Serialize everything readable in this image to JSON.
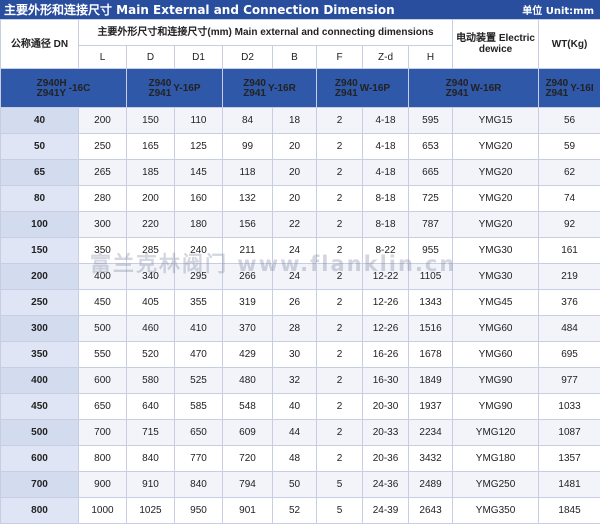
{
  "title": "主要外形和连接尺寸 Main External and Connection Dimension",
  "unit": "单位 Unit:mm",
  "headers": {
    "dn": "公称通径 DN",
    "dims_group": "主要外形尺寸和连接尺寸(mm) Main external and connecting dimensions",
    "electric": "电动装置 Electric dewice",
    "wt": "WT(Kg)",
    "cols": [
      "L",
      "D",
      "D1",
      "D2",
      "B",
      "F",
      "Z-d",
      "H"
    ]
  },
  "models": [
    {
      "top": "Z940H",
      "bottom": "Z941Y",
      "suffix": "-16C"
    },
    {
      "top": "Z940",
      "bottom": "Z941",
      "suffix": "Y-16P"
    },
    {
      "top": "Z940",
      "bottom": "Z941",
      "suffix": "Y-16R"
    },
    {
      "top": "Z940",
      "bottom": "Z941",
      "suffix": "W-16P"
    },
    {
      "top": "Z940",
      "bottom": "Z941",
      "suffix": "W-16R"
    },
    {
      "top": "Z940",
      "bottom": "Z941",
      "suffix": "Y-16I"
    }
  ],
  "rows": [
    [
      "40",
      "200",
      "150",
      "110",
      "84",
      "18",
      "2",
      "4-18",
      "595",
      "YMG15",
      "56"
    ],
    [
      "50",
      "250",
      "165",
      "125",
      "99",
      "20",
      "2",
      "4-18",
      "653",
      "YMG20",
      "59"
    ],
    [
      "65",
      "265",
      "185",
      "145",
      "118",
      "20",
      "2",
      "4-18",
      "665",
      "YMG20",
      "62"
    ],
    [
      "80",
      "280",
      "200",
      "160",
      "132",
      "20",
      "2",
      "8-18",
      "725",
      "YMG20",
      "74"
    ],
    [
      "100",
      "300",
      "220",
      "180",
      "156",
      "22",
      "2",
      "8-18",
      "787",
      "YMG20",
      "92"
    ],
    [
      "150",
      "350",
      "285",
      "240",
      "211",
      "24",
      "2",
      "8-22",
      "955",
      "YMG30",
      "161"
    ],
    [
      "200",
      "400",
      "340",
      "295",
      "266",
      "24",
      "2",
      "12-22",
      "1105",
      "YMG30",
      "219"
    ],
    [
      "250",
      "450",
      "405",
      "355",
      "319",
      "26",
      "2",
      "12-26",
      "1343",
      "YMG45",
      "376"
    ],
    [
      "300",
      "500",
      "460",
      "410",
      "370",
      "28",
      "2",
      "12-26",
      "1516",
      "YMG60",
      "484"
    ],
    [
      "350",
      "550",
      "520",
      "470",
      "429",
      "30",
      "2",
      "16-26",
      "1678",
      "YMG60",
      "695"
    ],
    [
      "400",
      "600",
      "580",
      "525",
      "480",
      "32",
      "2",
      "16-30",
      "1849",
      "YMG90",
      "977"
    ],
    [
      "450",
      "650",
      "640",
      "585",
      "548",
      "40",
      "2",
      "20-30",
      "1937",
      "YMG90",
      "1033"
    ],
    [
      "500",
      "700",
      "715",
      "650",
      "609",
      "44",
      "2",
      "20-33",
      "2234",
      "YMG120",
      "1087"
    ],
    [
      "600",
      "800",
      "840",
      "770",
      "720",
      "48",
      "2",
      "20-36",
      "3432",
      "YMG180",
      "1357"
    ],
    [
      "700",
      "900",
      "910",
      "840",
      "794",
      "50",
      "5",
      "24-36",
      "2489",
      "YMG250",
      "1481"
    ],
    [
      "800",
      "1000",
      "1025",
      "950",
      "901",
      "52",
      "5",
      "24-39",
      "2643",
      "YMG350",
      "1845"
    ]
  ],
  "watermark": "富兰克林阀门   www.flanklin.cn"
}
